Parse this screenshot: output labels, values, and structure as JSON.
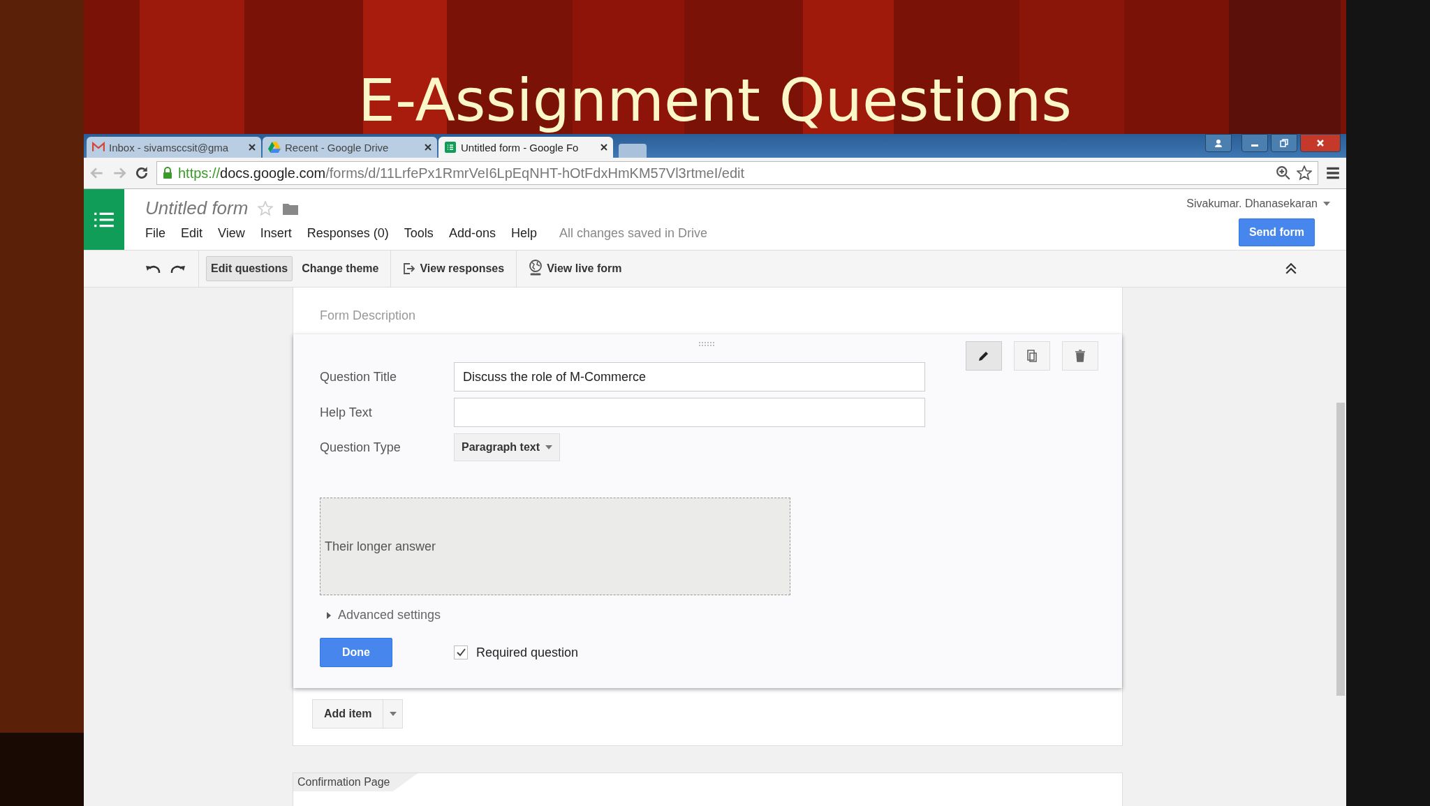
{
  "slide": {
    "title": "E-Assignment Questions"
  },
  "browser": {
    "tabs": [
      {
        "label": "Inbox - sivamsccsit@gma",
        "selected": false
      },
      {
        "label": "Recent - Google Drive",
        "selected": false
      },
      {
        "label": "Untitled form - Google Fo",
        "selected": true
      }
    ],
    "url": {
      "scheme": "https://",
      "host": "docs.google.com",
      "path": "/forms/d/11LrfePx1RmrVeI6LpEqNHT-hOtFdxHmKM57Vl3rtmeI/edit"
    }
  },
  "app": {
    "doc_title": "Untitled form",
    "user": "Sivakumar. Dhanasekaran",
    "menu": [
      "File",
      "Edit",
      "View",
      "Insert",
      "Responses (0)",
      "Tools",
      "Add-ons",
      "Help"
    ],
    "save_status": "All changes saved in Drive",
    "send_button": "Send form"
  },
  "toolbar": [
    {
      "label": "Edit questions",
      "selected": true
    },
    {
      "label": "Change theme",
      "selected": false
    },
    {
      "label": "View responses",
      "selected": false
    },
    {
      "label": "View live form",
      "selected": false
    }
  ],
  "form": {
    "description_placeholder": "Form Description",
    "question": {
      "fields": [
        {
          "label": "Question Title",
          "kind": "text",
          "value": "Discuss the role of M-Commerce"
        },
        {
          "label": "Help Text",
          "kind": "text"
        },
        {
          "label": "Question Type",
          "kind": "dropdown",
          "value": "Paragraph text"
        }
      ],
      "answer_placeholder": "Their longer answer",
      "advanced": "Advanced settings",
      "expanded": false,
      "done_button": "Done",
      "required": {
        "label": "Required question",
        "checked": true
      }
    },
    "add_item": "Add item",
    "confirmation_tab": "Confirmation Page"
  }
}
